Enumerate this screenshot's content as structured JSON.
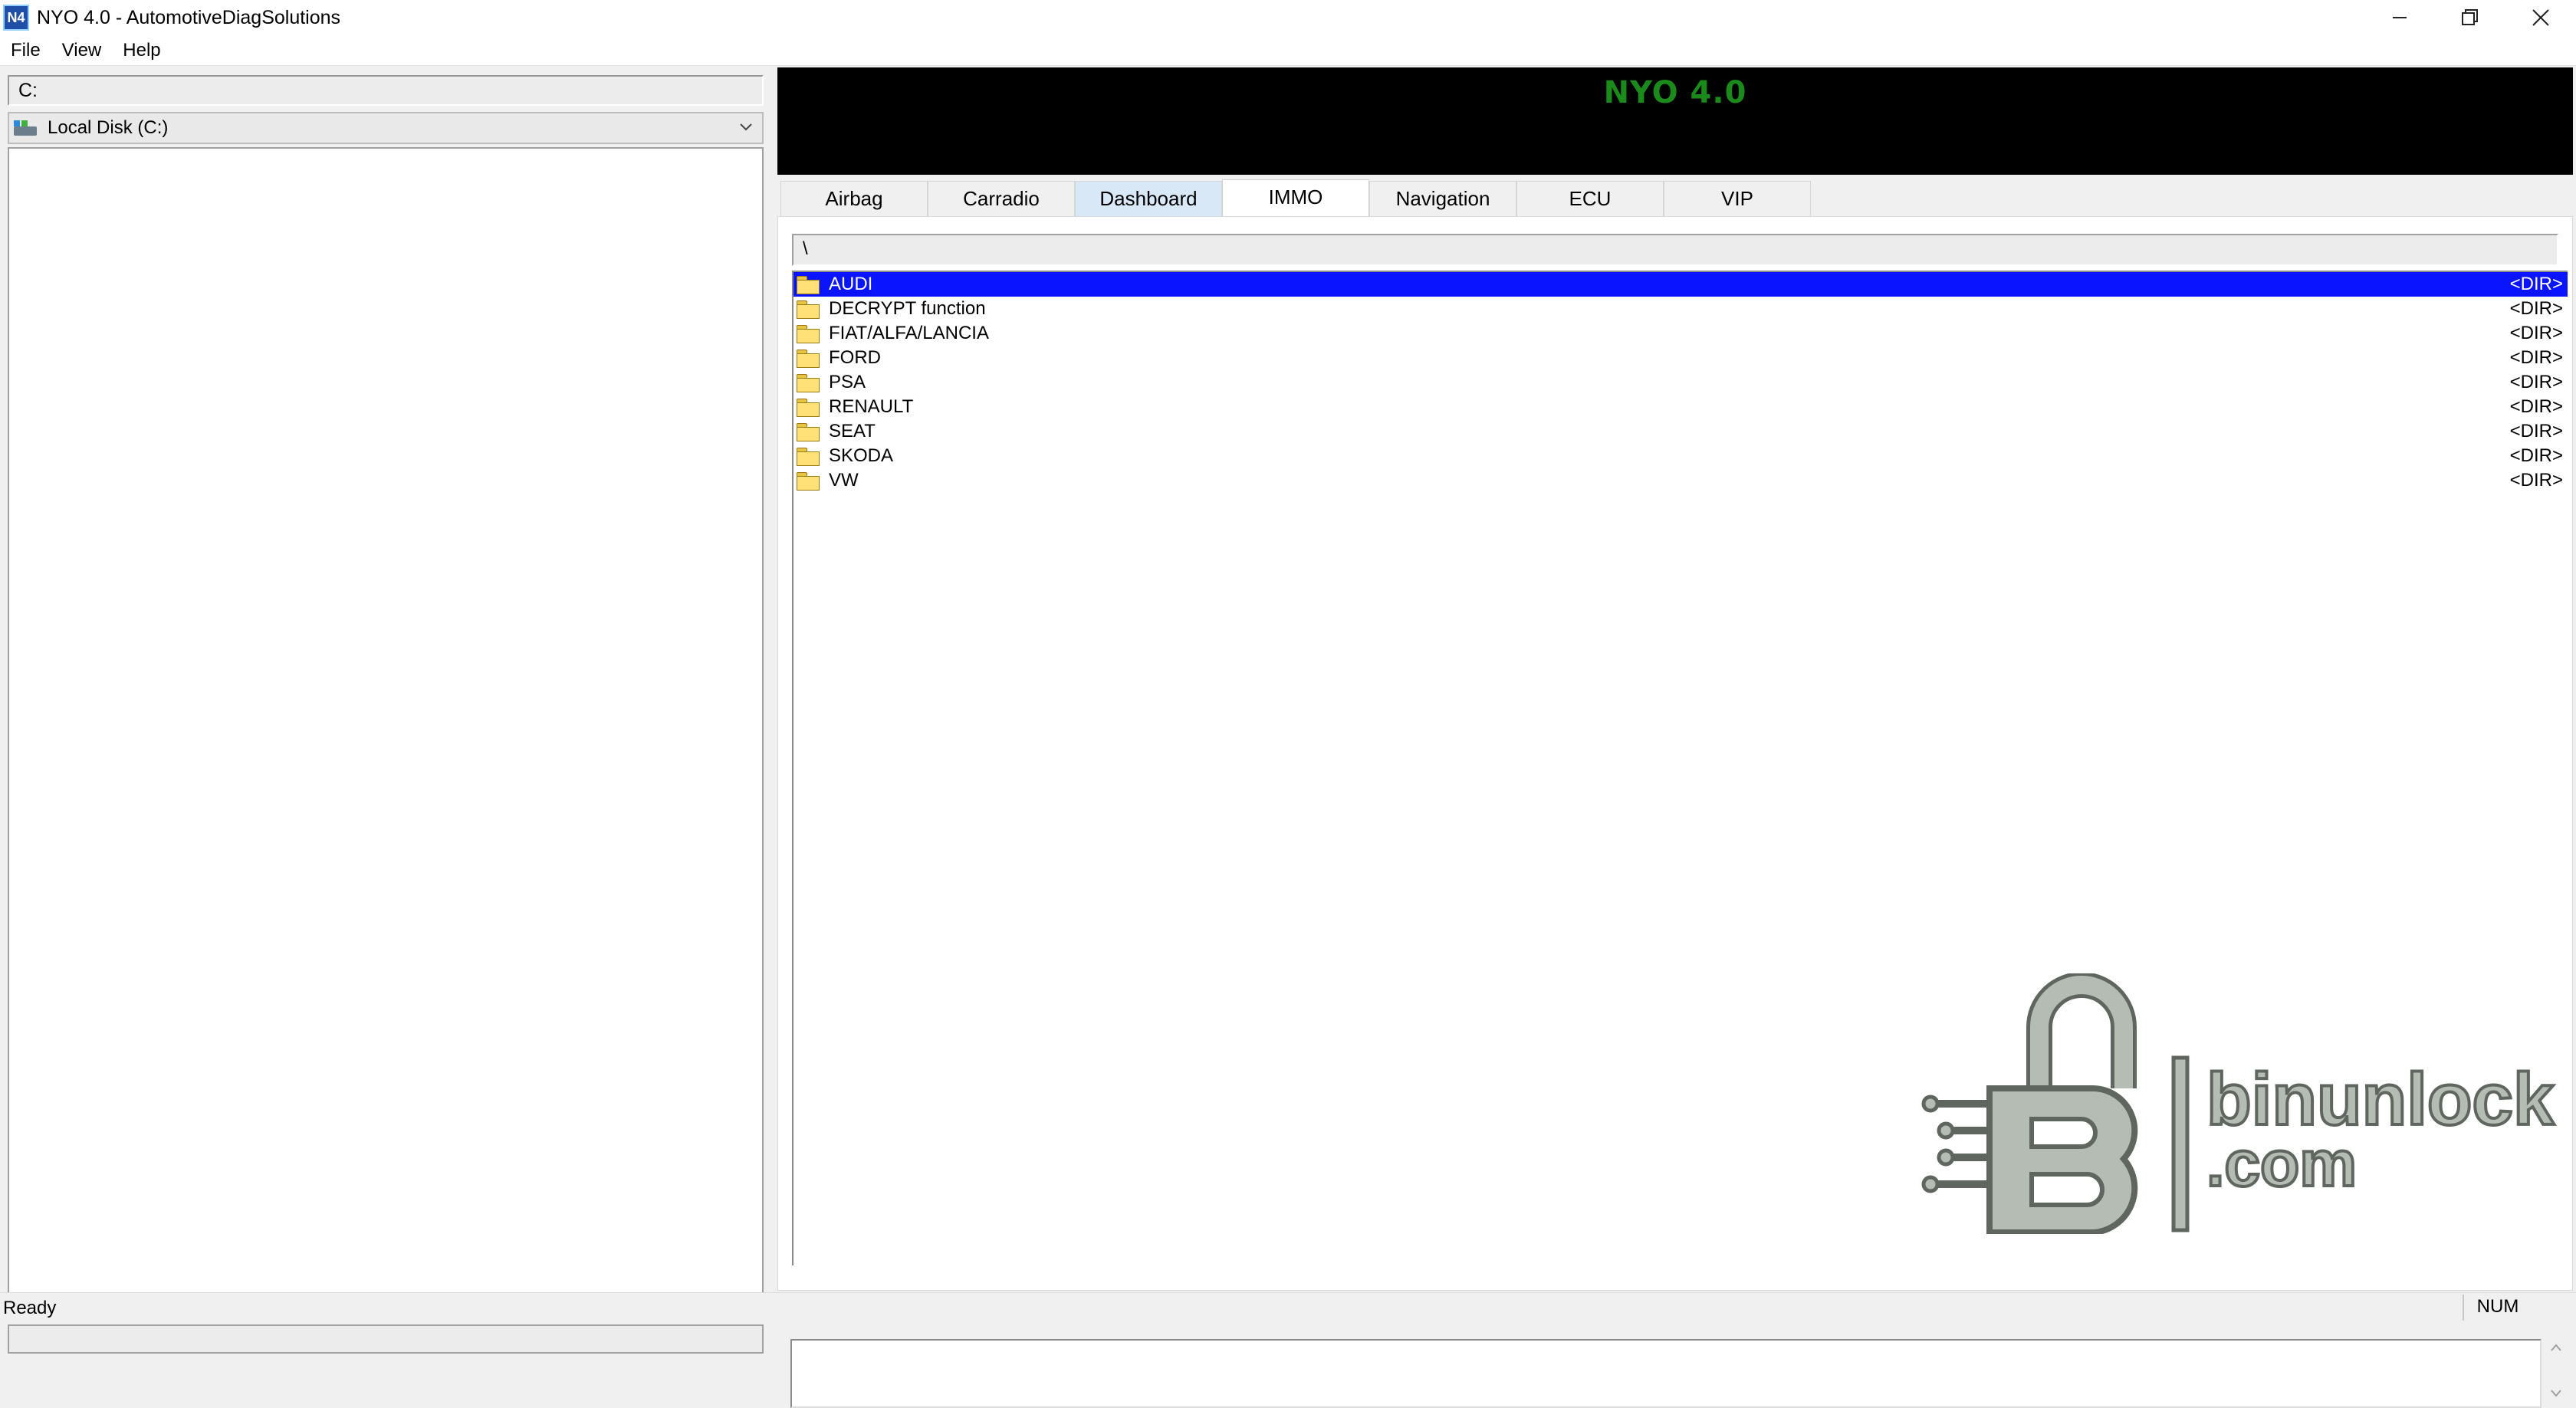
{
  "window": {
    "icon_label": "N4",
    "title": "NYO 4.0 - AutomotiveDiagSolutions",
    "controls": [
      "minimize",
      "restore",
      "close"
    ]
  },
  "menu": [
    "File",
    "View",
    "Help"
  ],
  "left": {
    "path": "C:",
    "drive": "Local Disk (C:)"
  },
  "banner": {
    "title": "NYO 4.0",
    "color": "#1a8a1a"
  },
  "tabs": [
    {
      "label": "Airbag",
      "state": "normal"
    },
    {
      "label": "Carradio",
      "state": "normal"
    },
    {
      "label": "Dashboard",
      "state": "hover"
    },
    {
      "label": "IMMO",
      "state": "active"
    },
    {
      "label": "Navigation",
      "state": "normal"
    },
    {
      "label": "ECU",
      "state": "normal"
    },
    {
      "label": "VIP",
      "state": "normal"
    }
  ],
  "directory": {
    "path": "\\",
    "entries": [
      {
        "name": "AUDI",
        "type": "<DIR>",
        "selected": true
      },
      {
        "name": "DECRYPT function",
        "type": "<DIR>",
        "selected": false
      },
      {
        "name": "FIAT/ALFA/LANCIA",
        "type": "<DIR>",
        "selected": false
      },
      {
        "name": "FORD",
        "type": "<DIR>",
        "selected": false
      },
      {
        "name": "PSA",
        "type": "<DIR>",
        "selected": false
      },
      {
        "name": "RENAULT",
        "type": "<DIR>",
        "selected": false
      },
      {
        "name": "SEAT",
        "type": "<DIR>",
        "selected": false
      },
      {
        "name": "SKODA",
        "type": "<DIR>",
        "selected": false
      },
      {
        "name": "VW",
        "type": "<DIR>",
        "selected": false
      }
    ],
    "selection_color": "#0a14ff"
  },
  "watermark": {
    "line1": "binunlock",
    "line2": ".com"
  },
  "status": {
    "text": "Ready",
    "indicator": "NUM"
  }
}
